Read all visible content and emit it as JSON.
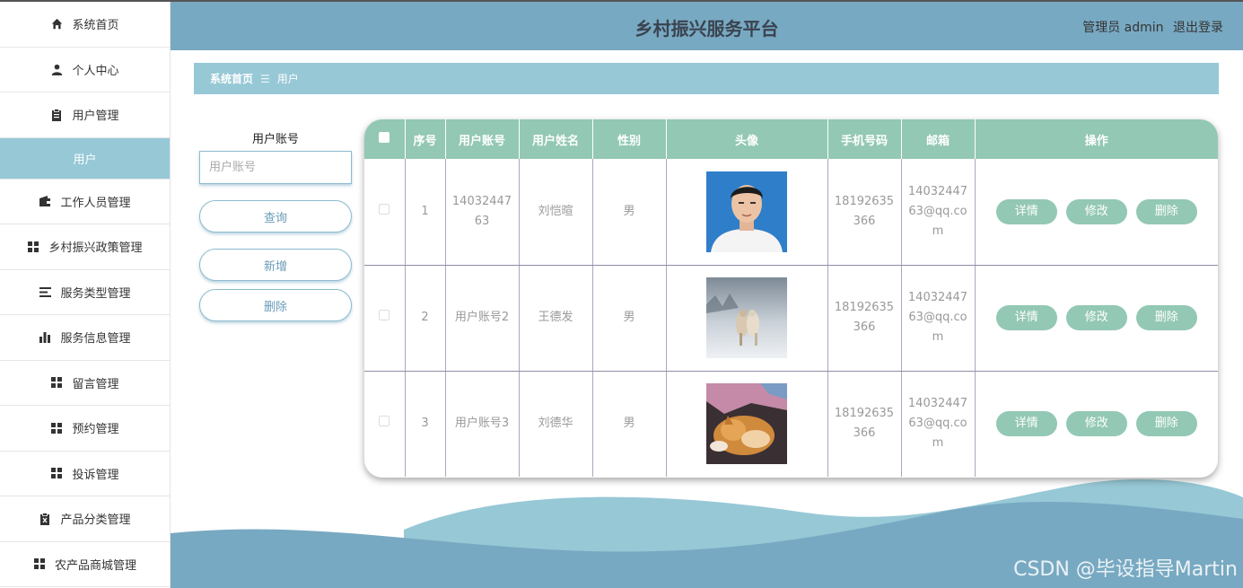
{
  "header": {
    "title": "乡村振兴服务平台",
    "user_label": "管理员 admin",
    "logout_label": "退出登录"
  },
  "sidebar": {
    "items": [
      {
        "label": "系统首页",
        "icon": "home-icon"
      },
      {
        "label": "个人中心",
        "icon": "person-icon"
      },
      {
        "label": "用户管理",
        "icon": "clipboard-icon"
      },
      {
        "label": "用户",
        "icon": ""
      },
      {
        "label": "工作人员管理",
        "icon": "wallet-icon"
      },
      {
        "label": "乡村振兴政策管理",
        "icon": "grid-icon"
      },
      {
        "label": "服务类型管理",
        "icon": "list-icon"
      },
      {
        "label": "服务信息管理",
        "icon": "bar-chart-icon"
      },
      {
        "label": "留言管理",
        "icon": "grid-icon"
      },
      {
        "label": "预约管理",
        "icon": "grid-icon"
      },
      {
        "label": "投诉管理",
        "icon": "grid-icon"
      },
      {
        "label": "产品分类管理",
        "icon": "clipboard-x-icon"
      },
      {
        "label": "农产品商城管理",
        "icon": "grid-icon"
      }
    ]
  },
  "breadcrumb": {
    "home": "系统首页",
    "separator": "☰",
    "current": "用户"
  },
  "search": {
    "label": "用户账号",
    "placeholder": "用户账号",
    "query_label": "查询",
    "add_label": "新增",
    "delete_label": "删除"
  },
  "table": {
    "columns": [
      "",
      "序号",
      "用户账号",
      "用户姓名",
      "性别",
      "头像",
      "手机号码",
      "邮箱",
      "操作"
    ],
    "actions": {
      "detail": "详情",
      "edit": "修改",
      "delete": "删除"
    },
    "rows": [
      {
        "index": "1",
        "account": "14032447 63",
        "name": "刘恺暄",
        "gender": "男",
        "avatar": "portrait-photo",
        "phone": "18192635 366",
        "email": "14032447 63@qq.co m"
      },
      {
        "index": "2",
        "account": "用户账号2",
        "name": "王德发",
        "gender": "男",
        "avatar": "snow-horses-photo",
        "phone": "18192635 366",
        "email": "14032447 63@qq.co m"
      },
      {
        "index": "3",
        "account": "用户账号3",
        "name": "刘德华",
        "gender": "男",
        "avatar": "cat-photo",
        "phone": "18192635 366",
        "email": "14032447 63@qq.co m"
      }
    ]
  },
  "watermark": "CSDN @毕设指导Martin",
  "colors": {
    "header": "#78a9c2",
    "accent": "#97c8d6",
    "table_header": "#93c8b4"
  }
}
